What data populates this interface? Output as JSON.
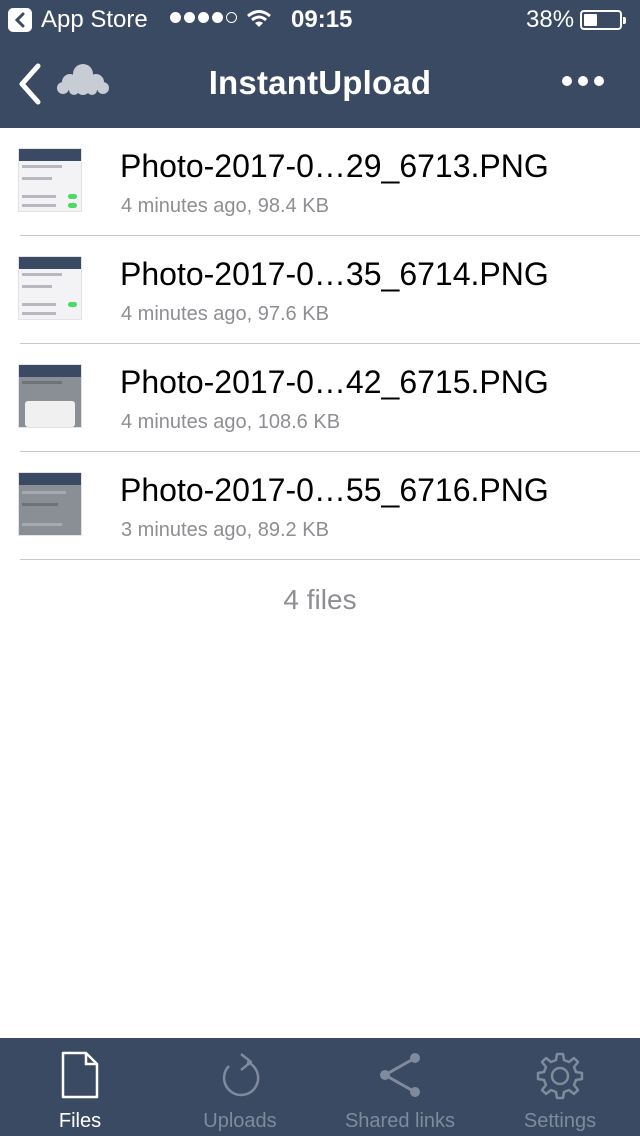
{
  "status_bar": {
    "back_app_label": "App Store",
    "time": "09:15",
    "battery": "38%"
  },
  "nav": {
    "title": "InstantUpload"
  },
  "files": [
    {
      "name": "Photo-2017-0…29_6713.PNG",
      "meta": "4 minutes ago, 98.4 KB"
    },
    {
      "name": "Photo-2017-0…35_6714.PNG",
      "meta": "4 minutes ago, 97.6 KB"
    },
    {
      "name": "Photo-2017-0…42_6715.PNG",
      "meta": "4 minutes ago, 108.6 KB"
    },
    {
      "name": "Photo-2017-0…55_6716.PNG",
      "meta": "3 minutes ago, 89.2 KB"
    }
  ],
  "file_count": "4 files",
  "tabs": [
    {
      "label": "Files",
      "icon": "file-icon"
    },
    {
      "label": "Uploads",
      "icon": "refresh-icon"
    },
    {
      "label": "Shared links",
      "icon": "share-icon"
    },
    {
      "label": "Settings",
      "icon": "gear-icon"
    }
  ],
  "colors": {
    "bar": "#3a4a63",
    "inactive_tab": "#7f8a9c",
    "secondary_text": "#8e8e93"
  }
}
